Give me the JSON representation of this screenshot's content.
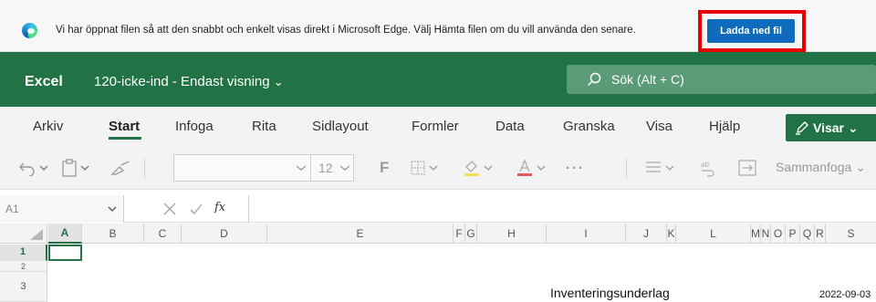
{
  "infobar": {
    "message": "Vi har öppnat filen så att den snabbt och enkelt visas direkt i Microsoft Edge. Välj Hämta filen om du vill använda den senare.",
    "download_label": "Ladda ned fil",
    "button_color": "#0f6cbd",
    "highlight_color": "#e60000"
  },
  "app": {
    "name": "Excel",
    "doc_title": "120-icke-ind - Endast visning",
    "title_caret": "⌄",
    "brand_color": "#217346",
    "search_placeholder": "Sök (Alt + C)"
  },
  "ribbon": {
    "tabs": [
      "Arkiv",
      "Start",
      "Infoga",
      "Rita",
      "Sidlayout",
      "Formler",
      "Data",
      "Granska",
      "Visa",
      "Hjälp"
    ],
    "active_tab": "Start",
    "view_mode_label": "Visar",
    "view_mode_caret": "⌄"
  },
  "toolbar": {
    "font_size": "12",
    "bold": "F",
    "ellipsis": "···",
    "merge_label": "Sammanfoga",
    "merge_caret": "⌄"
  },
  "formula_bar": {
    "cell_ref": "A1",
    "fx": "fx"
  },
  "grid": {
    "columns": [
      "A",
      "B",
      "C",
      "D",
      "E",
      "F",
      "G",
      "H",
      "I",
      "J",
      "K",
      "L",
      "M",
      "N",
      "O",
      "P",
      "Q",
      "R",
      "S"
    ],
    "selected_column": "A",
    "rows": [
      "1",
      "2",
      "3"
    ],
    "selected_row": "1",
    "cells": {
      "title": "Inventeringsunderlag",
      "date": "2022-09-03"
    }
  }
}
